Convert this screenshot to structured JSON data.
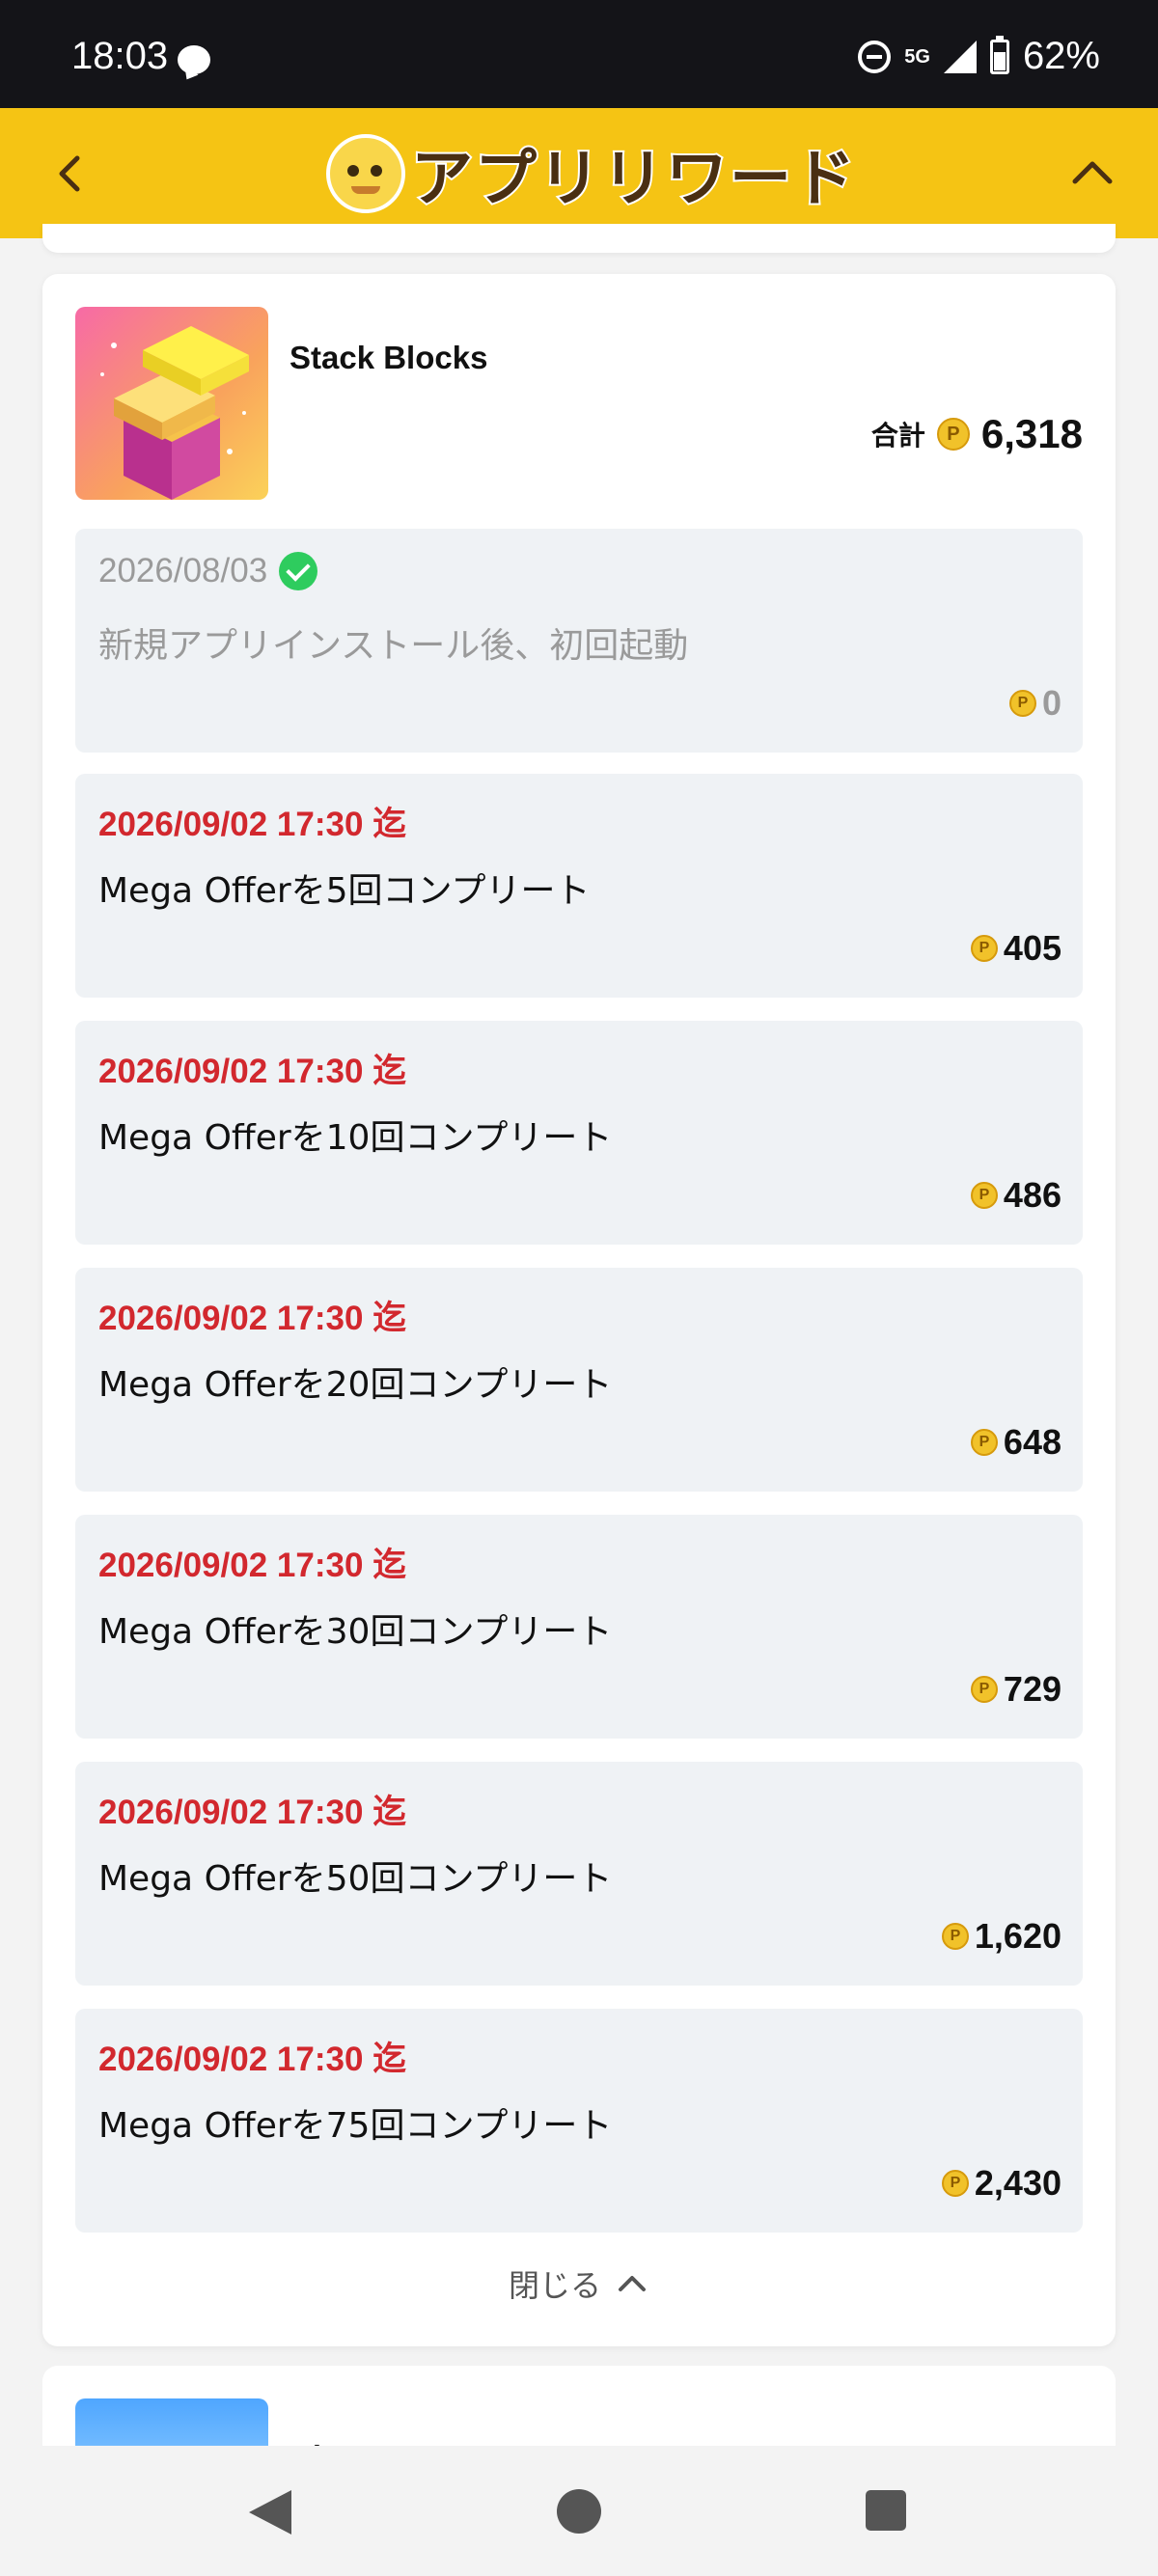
{
  "status_bar": {
    "time": "18:03",
    "network": "5G",
    "battery": "62%",
    "battery_level": 0.62
  },
  "header": {
    "logo_text": "アプリリワード",
    "brand_color": "#f5c414"
  },
  "card": {
    "app_name": "Stack Blocks",
    "total_label": "合計",
    "total_points": "6,318",
    "items": [
      {
        "date": "2026/08/03",
        "completed": true,
        "description": "新規アプリインストール後、初回起動",
        "points": "0"
      },
      {
        "date": "2026/09/02 17:30 迄",
        "completed": false,
        "description": "Mega Offerを5回コンプリート",
        "points": "405"
      },
      {
        "date": "2026/09/02 17:30 迄",
        "completed": false,
        "description": "Mega Offerを10回コンプリート",
        "points": "486"
      },
      {
        "date": "2026/09/02 17:30 迄",
        "completed": false,
        "description": "Mega Offerを20回コンプリート",
        "points": "648"
      },
      {
        "date": "2026/09/02 17:30 迄",
        "completed": false,
        "description": "Mega Offerを30回コンプリート",
        "points": "729"
      },
      {
        "date": "2026/09/02 17:30 迄",
        "completed": false,
        "description": "Mega Offerを50回コンプリート",
        "points": "1,620"
      },
      {
        "date": "2026/09/02 17:30 迄",
        "completed": false,
        "description": "Mega Offerを75回コンプリート",
        "points": "2,430"
      }
    ],
    "close_label": "閉じる"
  },
  "next_card": {
    "app_name": "Dice Dreams"
  },
  "icons": {
    "coin": "P",
    "back": "chevron-left-icon",
    "collapse": "chevron-up-icon"
  },
  "colors": {
    "deadline": "#d2282e",
    "completed_check": "#2ecc5e",
    "item_bg": "#eff2f5"
  }
}
